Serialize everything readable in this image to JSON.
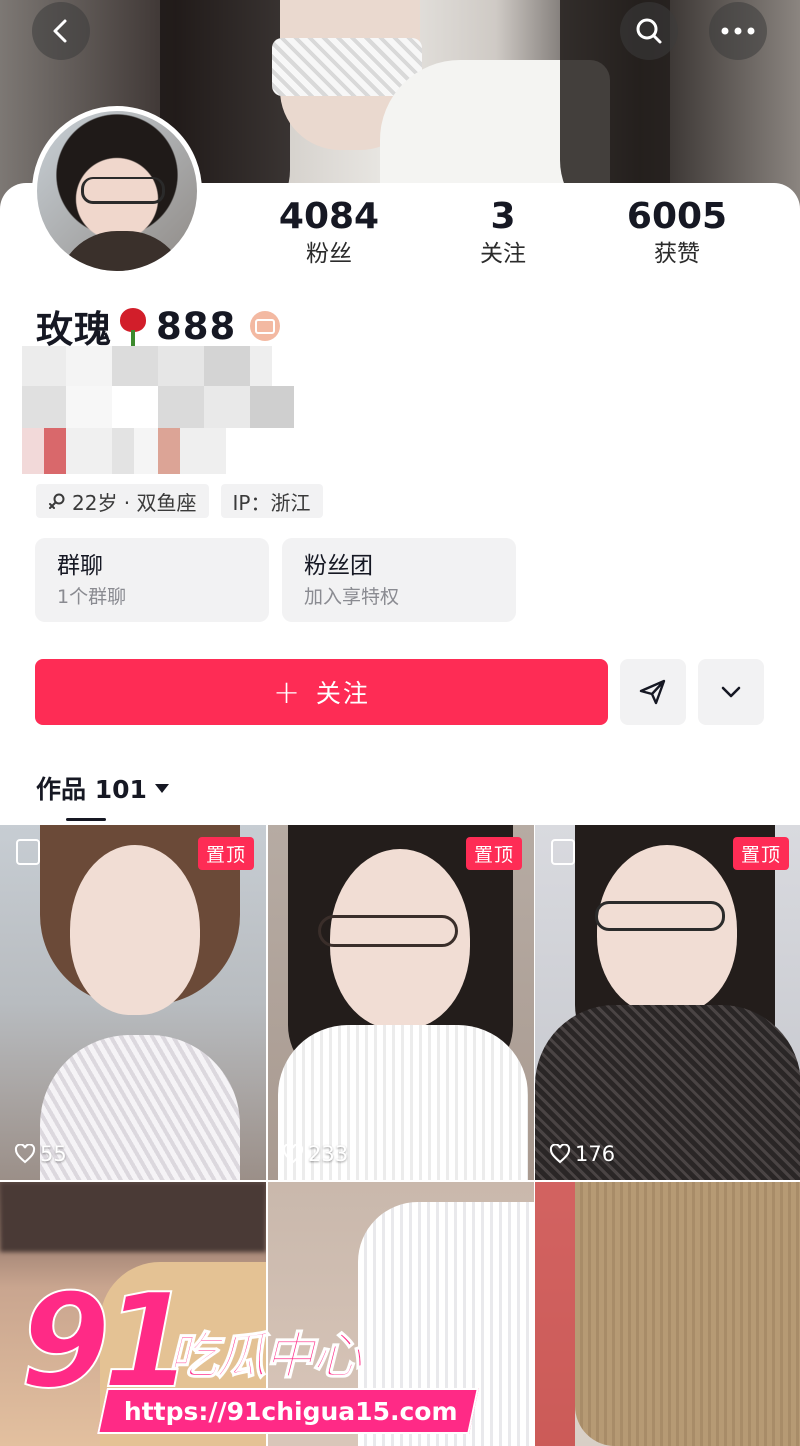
{
  "header": {
    "back_icon": "chevron-left-icon",
    "search_icon": "search-icon",
    "more_icon": "more-horizontal-icon"
  },
  "profile": {
    "name": "玫瑰🌹888",
    "name_prefix": "玫瑰",
    "name_suffix": "888",
    "stats": [
      {
        "value": "4084",
        "label": "粉丝"
      },
      {
        "value": "3",
        "label": "关注"
      },
      {
        "value": "6005",
        "label": "获赞"
      }
    ],
    "tags": {
      "age_zodiac": "22岁 · 双鱼座",
      "ip": "IP：浙江"
    },
    "entries": [
      {
        "title": "群聊",
        "subtitle": "1个群聊"
      },
      {
        "title": "粉丝团",
        "subtitle": "加入享特权"
      }
    ]
  },
  "actions": {
    "follow_label": "关注",
    "share_icon": "send-icon",
    "more_icon": "chevron-down-icon"
  },
  "works": {
    "tab_label": "作品 101",
    "pinned_label": "置顶",
    "items": [
      {
        "likes": "55",
        "pinned": true
      },
      {
        "likes": "233",
        "pinned": true
      },
      {
        "likes": "176",
        "pinned": true
      },
      {
        "likes": "",
        "pinned": false
      },
      {
        "likes": "",
        "pinned": false
      },
      {
        "likes": "",
        "pinned": false
      }
    ]
  },
  "watermark": {
    "number": "91",
    "text": "吃瓜中心",
    "url": "https://91chigua15.com"
  },
  "colors": {
    "accent": "#fe2c55",
    "watermark": "#ff2a86",
    "chip_bg": "#f2f2f3"
  }
}
